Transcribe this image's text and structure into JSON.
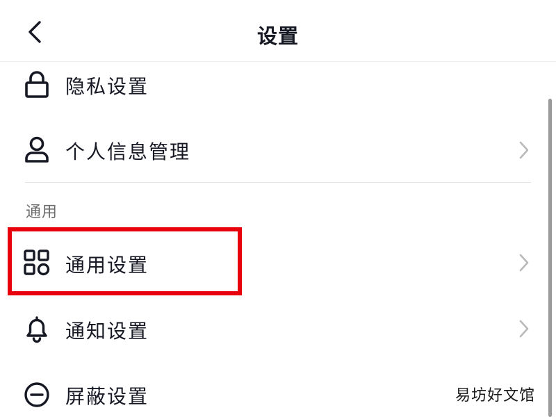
{
  "header": {
    "title": "设置"
  },
  "rows": [
    {
      "label": "隐私设置",
      "icon": "lock-icon"
    },
    {
      "label": "个人信息管理",
      "icon": "user-icon"
    },
    {
      "label": "通用设置",
      "icon": "grid-icon"
    },
    {
      "label": "通知设置",
      "icon": "bell-icon"
    },
    {
      "label": "屏蔽设置",
      "icon": "block-icon"
    }
  ],
  "section": {
    "general": "通用"
  },
  "watermark": "易坊好文馆",
  "colors": {
    "highlight": "#e8000b",
    "text": "#161823",
    "section_text": "#6b6b6b",
    "chevron": "#b9b9b9"
  }
}
